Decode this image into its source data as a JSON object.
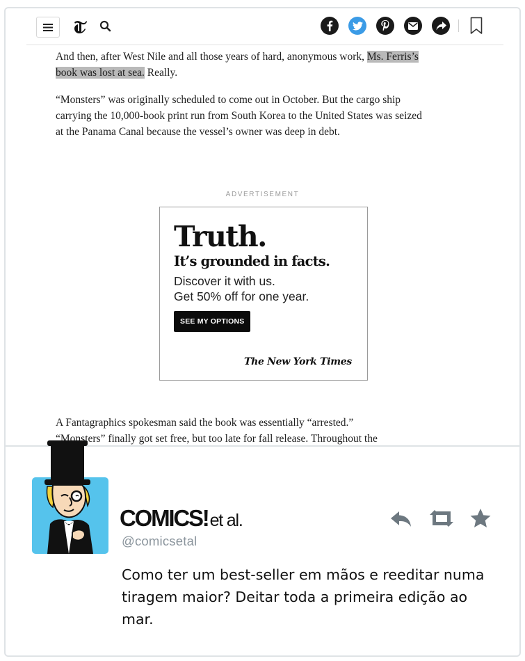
{
  "toolbar": {
    "icons": [
      "menu-icon",
      "nyt-t-logo",
      "search-icon",
      "facebook-icon",
      "twitter-icon",
      "pinterest-icon",
      "email-icon",
      "share-icon",
      "bookmark-icon"
    ],
    "twitter_color": "#3b9be6"
  },
  "article": {
    "p1_before": "And then, after West Nile and all those years of hard, anonymous work, ",
    "p1_highlight": "Ms. Ferris’s book was lost at sea.",
    "p1_after": " Really.",
    "p2": "“Monsters” was originally scheduled to come out in October. But the cargo ship carrying the 10,000-book print run from South Korea to the United States was seized at the Panama Canal because the vessel’s owner was deep in debt.",
    "p3_line1": "A Fantagraphics spokesman said the book was essentially “arrested.”",
    "p3_line2": "“Monsters” finally got set free, but too late for fall release. Throughout the"
  },
  "ad": {
    "label": "ADVERTISEMENT",
    "headline": "Truth.",
    "subhead": "It’s grounded in facts.",
    "line1": "Discover it with us.",
    "line2": "Get 50% off for one year.",
    "cta": "SEE MY OPTIONS",
    "brand": "The New York Times"
  },
  "tweet": {
    "name": "COMICS!",
    "name_suffix": "et al.",
    "handle": "@comicsetal",
    "text": "Como ter um best-seller em mãos e reeditar numa tiragem maior? Deitar toda a primeira edição ao mar.",
    "avatar_bg": "#55c3ec",
    "action_icons": [
      "reply-icon",
      "retweet-icon",
      "favorite-star-icon"
    ],
    "action_color": "#6d7880"
  }
}
